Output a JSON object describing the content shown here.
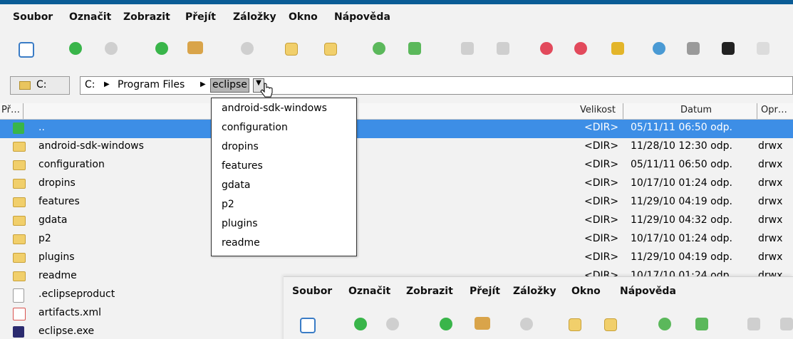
{
  "menu": [
    "Soubor",
    "Označit",
    "Zobrazit",
    "Přejít",
    "Záložky",
    "Okno",
    "Nápověda"
  ],
  "toolbar_icons": [
    "new-window-icon",
    "back-icon",
    "forward-icon",
    "up-icon",
    "home-icon",
    "stop-icon",
    "new-folder-icon",
    "delete-folder-icon",
    "refresh-icon",
    "sync-icon",
    "cut-icon",
    "copy-icon",
    "favorite-add-icon",
    "favorite-icon",
    "key-icon",
    "network-icon",
    "connect-icon",
    "terminal-icon",
    "more-icon"
  ],
  "address": {
    "drive": "C:",
    "path": [
      "C:",
      "Program Files",
      "eclipse"
    ]
  },
  "columns": {
    "name": "Př…",
    "size": "Velikost",
    "date": "Datum",
    "perm": "Opr…"
  },
  "rows": [
    {
      "name": "..",
      "size": "<DIR>",
      "date": "05/11/11 06:50 odp.",
      "perm": "",
      "selected": true
    },
    {
      "name": "android-sdk-windows",
      "size": "<DIR>",
      "date": "11/28/10 12:30 odp.",
      "perm": "drwx"
    },
    {
      "name": "configuration",
      "size": "<DIR>",
      "date": "05/11/11 06:50 odp.",
      "perm": "drwx"
    },
    {
      "name": "dropins",
      "size": "<DIR>",
      "date": "10/17/10 01:24 odp.",
      "perm": "drwx"
    },
    {
      "name": "features",
      "size": "<DIR>",
      "date": "11/29/10 04:19 odp.",
      "perm": "drwx"
    },
    {
      "name": "gdata",
      "size": "<DIR>",
      "date": "11/29/10 04:32 odp.",
      "perm": "drwx"
    },
    {
      "name": "p2",
      "size": "<DIR>",
      "date": "10/17/10 01:24 odp.",
      "perm": "drwx"
    },
    {
      "name": "plugins",
      "size": "<DIR>",
      "date": "11/29/10 04:19 odp.",
      "perm": "drwx"
    },
    {
      "name": "readme",
      "size": "<DIR>",
      "date": "10/17/10 01:24 odp.",
      "perm": "drwx"
    },
    {
      "name": ".eclipseproduct",
      "size": "",
      "date": "",
      "perm": ""
    },
    {
      "name": "artifacts.xml",
      "size": "",
      "date": "",
      "perm": ""
    },
    {
      "name": "eclipse.exe",
      "size": "",
      "date": "",
      "perm": ""
    }
  ],
  "dropdown": [
    "android-sdk-windows",
    "configuration",
    "dropins",
    "features",
    "gdata",
    "p2",
    "plugins",
    "readme"
  ],
  "overlay_menu": [
    "Soubor",
    "Označit",
    "Zobrazit",
    "Přejít",
    "Záložky",
    "Okno",
    "Nápověda"
  ]
}
